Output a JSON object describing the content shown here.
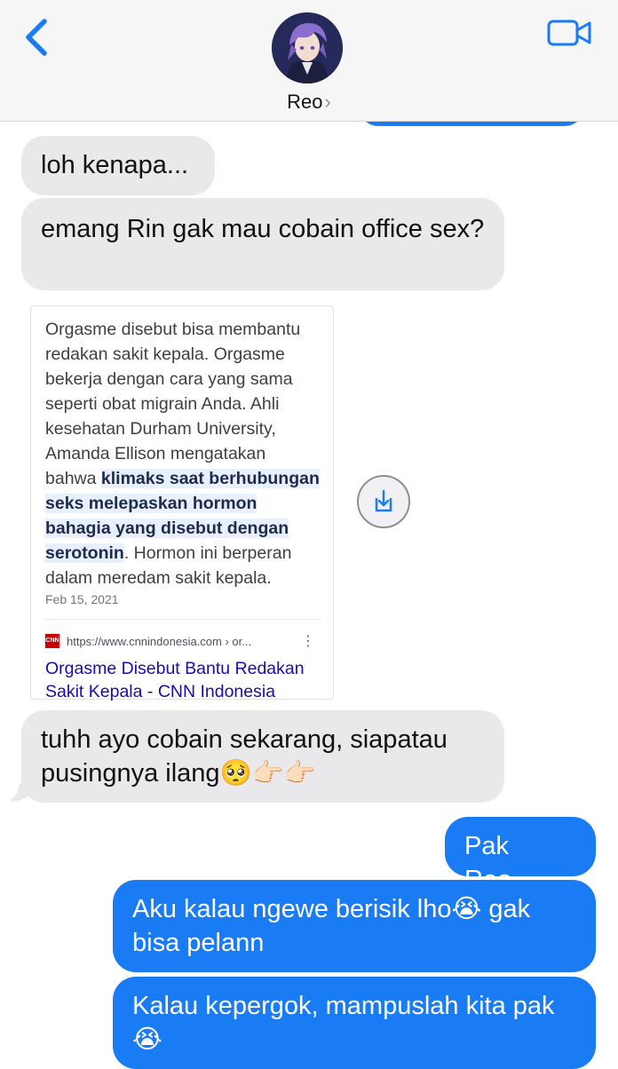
{
  "header": {
    "contact_name": "Reo",
    "chevron": "›",
    "back_icon": "chevron-left-icon",
    "video_icon": "video-camera-icon",
    "accent": "#1a7cf5"
  },
  "messages": {
    "m1": "loh kenapa...",
    "m2": "emang Rin gak mau cobain office sex?",
    "m3": "tuhh ayo cobain sekarang, siapatau pusingnya ilang🥺👉🏻👉🏻",
    "m4": "Pak Reo..",
    "m5": "Aku kalau ngewe berisik lho😭 gak bisa pelann",
    "m6": "Kalau kepergok, mampuslah kita pak😭"
  },
  "card": {
    "snippet_pre": "Orgasme disebut bisa membantu redakan sakit kepala. Orgasme bekerja dengan cara yang sama seperti obat migrain Anda. Ahli kesehatan Durham University, Amanda Ellison mengatakan bahwa ",
    "snippet_highlight": "klimaks saat berhubungan seks melepaskan hormon bahagia yang disebut dengan serotonin",
    "snippet_post": ". Hormon ini berperan dalam meredam sakit kepala.",
    "date": "Feb 15, 2021",
    "logo_text": "CNN",
    "source_url": "https://www.cnnindonesia.com › or...",
    "more_icon": "⋮",
    "title": "Orgasme Disebut Bantu Redakan Sakit Kepala - CNN Indonesia"
  },
  "colors": {
    "received_bubble": "#e9e9eb",
    "sent_bubble": "#1a7cf5",
    "highlight": "#e8f0fe",
    "link": "#1a0dab"
  }
}
